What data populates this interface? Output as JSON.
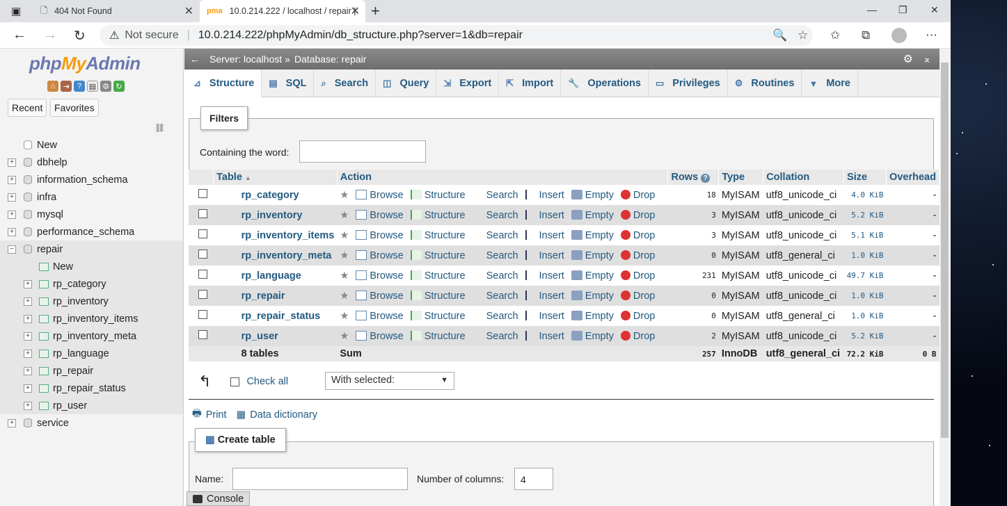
{
  "browser": {
    "tabs": [
      {
        "title": "404 Not Found"
      },
      {
        "title": "10.0.214.222 / localhost / repair |"
      }
    ],
    "address": {
      "security": "Not secure",
      "url": "10.0.214.222/phpMyAdmin/db_structure.php?server=1&db=repair"
    }
  },
  "sidebar": {
    "logo": {
      "php": "php",
      "my": "My",
      "admin": "Admin"
    },
    "recent_label": "Recent",
    "favorites_label": "Favorites",
    "tree": {
      "new": "New",
      "databases": [
        "dbhelp",
        "information_schema",
        "infra",
        "mysql",
        "performance_schema"
      ],
      "repair": {
        "name": "repair",
        "new": "New",
        "tables": [
          "rp_category",
          "rp_inventory",
          "rp_inventory_items",
          "rp_inventory_meta",
          "rp_language",
          "rp_repair",
          "rp_repair_status",
          "rp_user"
        ]
      },
      "after": [
        "service"
      ]
    }
  },
  "breadcrumb": {
    "server": "Server: localhost »",
    "database": "Database: repair"
  },
  "menu": [
    "Structure",
    "SQL",
    "Search",
    "Query",
    "Export",
    "Import",
    "Operations",
    "Privileges",
    "Routines",
    "More"
  ],
  "filters": {
    "legend": "Filters",
    "label": "Containing the word:"
  },
  "table": {
    "headers": [
      "Table",
      "Action",
      "Rows",
      "Type",
      "Collation",
      "Size",
      "Overhead"
    ],
    "actions": [
      "Browse",
      "Structure",
      "Search",
      "Insert",
      "Empty",
      "Drop"
    ],
    "rows": [
      {
        "name": "rp_category",
        "rows": "18",
        "type": "MyISAM",
        "collation": "utf8_unicode_ci",
        "size": "4.0 KiB",
        "overhead": "-"
      },
      {
        "name": "rp_inventory",
        "rows": "3",
        "type": "MyISAM",
        "collation": "utf8_unicode_ci",
        "size": "5.2 KiB",
        "overhead": "-"
      },
      {
        "name": "rp_inventory_items",
        "rows": "3",
        "type": "MyISAM",
        "collation": "utf8_unicode_ci",
        "size": "5.1 KiB",
        "overhead": "-"
      },
      {
        "name": "rp_inventory_meta",
        "rows": "0",
        "type": "MyISAM",
        "collation": "utf8_general_ci",
        "size": "1.0 KiB",
        "overhead": "-"
      },
      {
        "name": "rp_language",
        "rows": "231",
        "type": "MyISAM",
        "collation": "utf8_unicode_ci",
        "size": "49.7 KiB",
        "overhead": "-"
      },
      {
        "name": "rp_repair",
        "rows": "0",
        "type": "MyISAM",
        "collation": "utf8_unicode_ci",
        "size": "1.0 KiB",
        "overhead": "-"
      },
      {
        "name": "rp_repair_status",
        "rows": "0",
        "type": "MyISAM",
        "collation": "utf8_general_ci",
        "size": "1.0 KiB",
        "overhead": "-"
      },
      {
        "name": "rp_user",
        "rows": "2",
        "type": "MyISAM",
        "collation": "utf8_unicode_ci",
        "size": "5.2 KiB",
        "overhead": "-"
      }
    ],
    "footer": {
      "count": "8 tables",
      "sum": "Sum",
      "rows": "257",
      "type": "InnoDB",
      "collation": "utf8_general_ci",
      "size": "72.2 KiB",
      "overhead": "0 B"
    }
  },
  "bulk": {
    "check_all": "Check all",
    "with_selected": "With selected:"
  },
  "links": {
    "print": "Print",
    "dictionary": "Data dictionary"
  },
  "create": {
    "legend": "Create table",
    "name_label": "Name:",
    "columns_label": "Number of columns:",
    "columns_value": "4"
  },
  "console": "Console"
}
